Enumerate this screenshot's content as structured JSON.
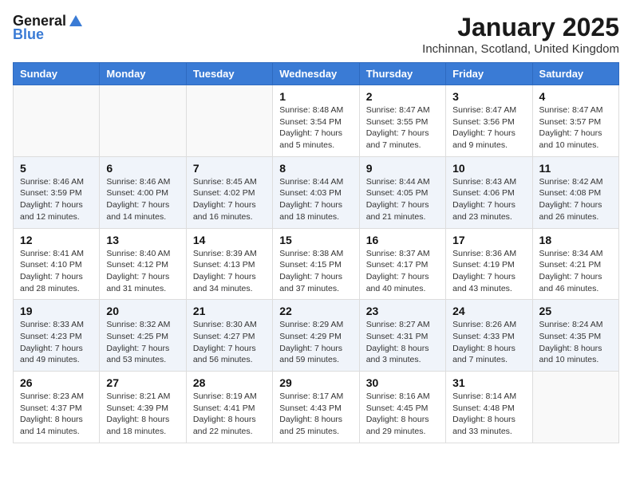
{
  "logo": {
    "line1": "General",
    "line2": "Blue"
  },
  "title": "January 2025",
  "subtitle": "Inchinnan, Scotland, United Kingdom",
  "days_of_week": [
    "Sunday",
    "Monday",
    "Tuesday",
    "Wednesday",
    "Thursday",
    "Friday",
    "Saturday"
  ],
  "weeks": [
    {
      "shaded": false,
      "days": [
        {
          "num": "",
          "info": ""
        },
        {
          "num": "",
          "info": ""
        },
        {
          "num": "",
          "info": ""
        },
        {
          "num": "1",
          "info": "Sunrise: 8:48 AM\nSunset: 3:54 PM\nDaylight: 7 hours\nand 5 minutes."
        },
        {
          "num": "2",
          "info": "Sunrise: 8:47 AM\nSunset: 3:55 PM\nDaylight: 7 hours\nand 7 minutes."
        },
        {
          "num": "3",
          "info": "Sunrise: 8:47 AM\nSunset: 3:56 PM\nDaylight: 7 hours\nand 9 minutes."
        },
        {
          "num": "4",
          "info": "Sunrise: 8:47 AM\nSunset: 3:57 PM\nDaylight: 7 hours\nand 10 minutes."
        }
      ]
    },
    {
      "shaded": true,
      "days": [
        {
          "num": "5",
          "info": "Sunrise: 8:46 AM\nSunset: 3:59 PM\nDaylight: 7 hours\nand 12 minutes."
        },
        {
          "num": "6",
          "info": "Sunrise: 8:46 AM\nSunset: 4:00 PM\nDaylight: 7 hours\nand 14 minutes."
        },
        {
          "num": "7",
          "info": "Sunrise: 8:45 AM\nSunset: 4:02 PM\nDaylight: 7 hours\nand 16 minutes."
        },
        {
          "num": "8",
          "info": "Sunrise: 8:44 AM\nSunset: 4:03 PM\nDaylight: 7 hours\nand 18 minutes."
        },
        {
          "num": "9",
          "info": "Sunrise: 8:44 AM\nSunset: 4:05 PM\nDaylight: 7 hours\nand 21 minutes."
        },
        {
          "num": "10",
          "info": "Sunrise: 8:43 AM\nSunset: 4:06 PM\nDaylight: 7 hours\nand 23 minutes."
        },
        {
          "num": "11",
          "info": "Sunrise: 8:42 AM\nSunset: 4:08 PM\nDaylight: 7 hours\nand 26 minutes."
        }
      ]
    },
    {
      "shaded": false,
      "days": [
        {
          "num": "12",
          "info": "Sunrise: 8:41 AM\nSunset: 4:10 PM\nDaylight: 7 hours\nand 28 minutes."
        },
        {
          "num": "13",
          "info": "Sunrise: 8:40 AM\nSunset: 4:12 PM\nDaylight: 7 hours\nand 31 minutes."
        },
        {
          "num": "14",
          "info": "Sunrise: 8:39 AM\nSunset: 4:13 PM\nDaylight: 7 hours\nand 34 minutes."
        },
        {
          "num": "15",
          "info": "Sunrise: 8:38 AM\nSunset: 4:15 PM\nDaylight: 7 hours\nand 37 minutes."
        },
        {
          "num": "16",
          "info": "Sunrise: 8:37 AM\nSunset: 4:17 PM\nDaylight: 7 hours\nand 40 minutes."
        },
        {
          "num": "17",
          "info": "Sunrise: 8:36 AM\nSunset: 4:19 PM\nDaylight: 7 hours\nand 43 minutes."
        },
        {
          "num": "18",
          "info": "Sunrise: 8:34 AM\nSunset: 4:21 PM\nDaylight: 7 hours\nand 46 minutes."
        }
      ]
    },
    {
      "shaded": true,
      "days": [
        {
          "num": "19",
          "info": "Sunrise: 8:33 AM\nSunset: 4:23 PM\nDaylight: 7 hours\nand 49 minutes."
        },
        {
          "num": "20",
          "info": "Sunrise: 8:32 AM\nSunset: 4:25 PM\nDaylight: 7 hours\nand 53 minutes."
        },
        {
          "num": "21",
          "info": "Sunrise: 8:30 AM\nSunset: 4:27 PM\nDaylight: 7 hours\nand 56 minutes."
        },
        {
          "num": "22",
          "info": "Sunrise: 8:29 AM\nSunset: 4:29 PM\nDaylight: 7 hours\nand 59 minutes."
        },
        {
          "num": "23",
          "info": "Sunrise: 8:27 AM\nSunset: 4:31 PM\nDaylight: 8 hours\nand 3 minutes."
        },
        {
          "num": "24",
          "info": "Sunrise: 8:26 AM\nSunset: 4:33 PM\nDaylight: 8 hours\nand 7 minutes."
        },
        {
          "num": "25",
          "info": "Sunrise: 8:24 AM\nSunset: 4:35 PM\nDaylight: 8 hours\nand 10 minutes."
        }
      ]
    },
    {
      "shaded": false,
      "days": [
        {
          "num": "26",
          "info": "Sunrise: 8:23 AM\nSunset: 4:37 PM\nDaylight: 8 hours\nand 14 minutes."
        },
        {
          "num": "27",
          "info": "Sunrise: 8:21 AM\nSunset: 4:39 PM\nDaylight: 8 hours\nand 18 minutes."
        },
        {
          "num": "28",
          "info": "Sunrise: 8:19 AM\nSunset: 4:41 PM\nDaylight: 8 hours\nand 22 minutes."
        },
        {
          "num": "29",
          "info": "Sunrise: 8:17 AM\nSunset: 4:43 PM\nDaylight: 8 hours\nand 25 minutes."
        },
        {
          "num": "30",
          "info": "Sunrise: 8:16 AM\nSunset: 4:45 PM\nDaylight: 8 hours\nand 29 minutes."
        },
        {
          "num": "31",
          "info": "Sunrise: 8:14 AM\nSunset: 4:48 PM\nDaylight: 8 hours\nand 33 minutes."
        },
        {
          "num": "",
          "info": ""
        }
      ]
    }
  ]
}
